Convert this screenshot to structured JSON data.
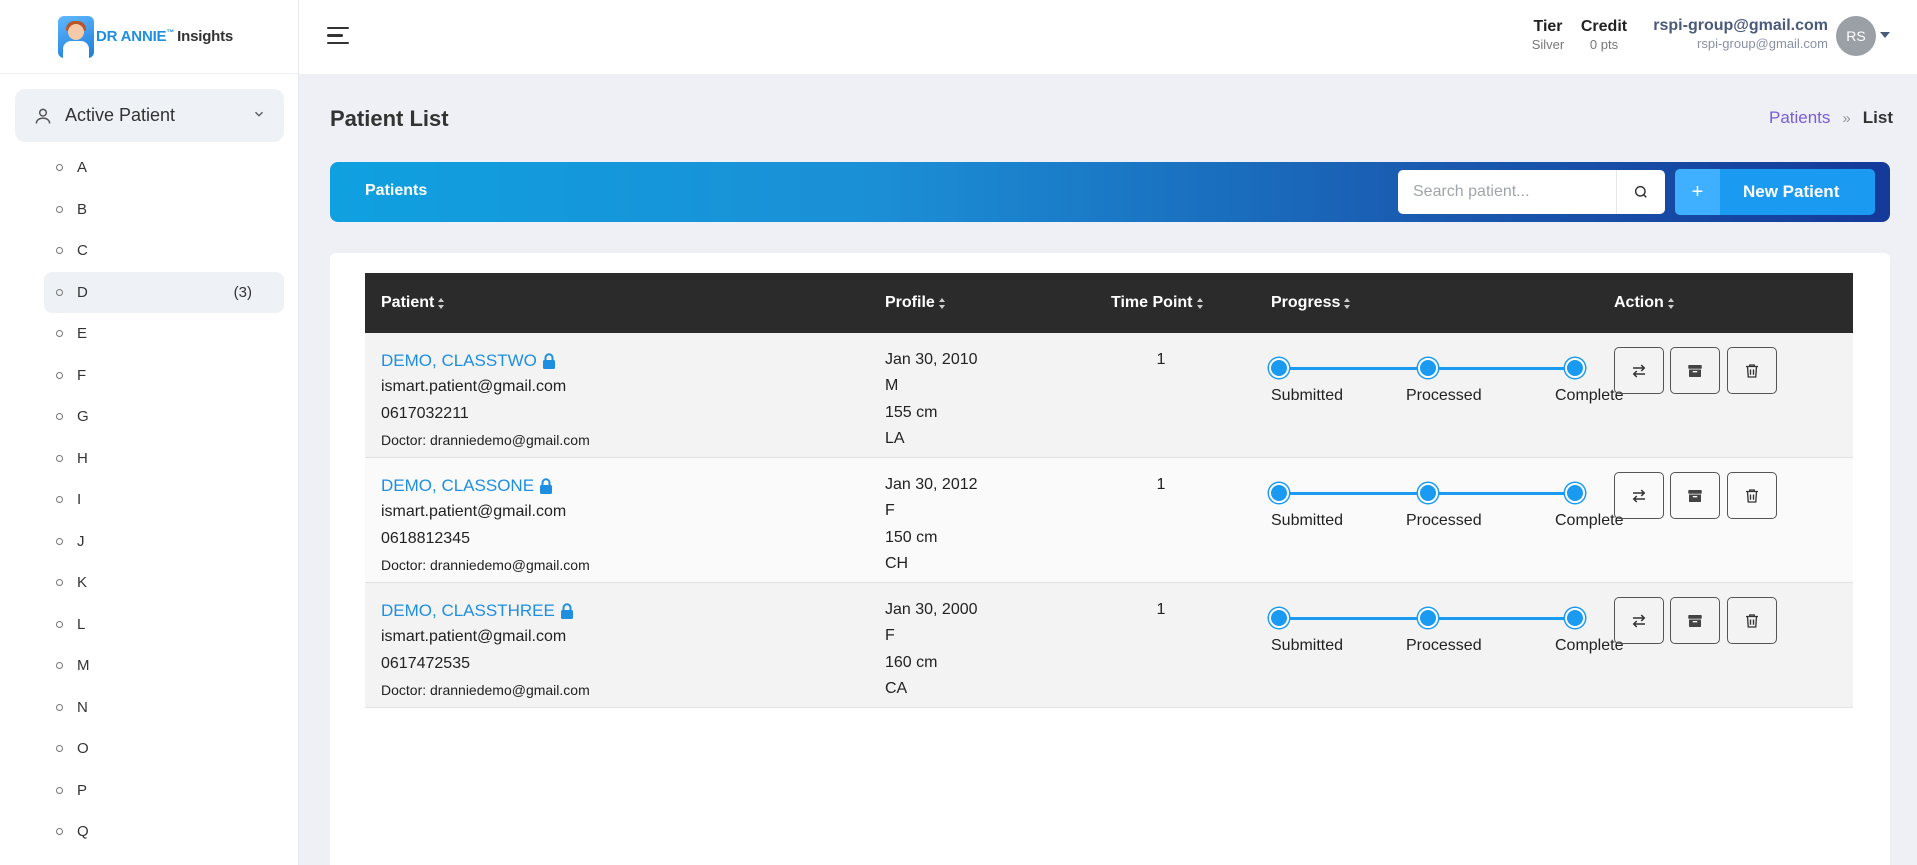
{
  "app": {
    "logo_brand": "DR ANNIE",
    "logo_tm": "™",
    "logo_suffix": "Insights"
  },
  "header": {
    "tier_title": "Tier",
    "tier_value": "Silver",
    "credit_title": "Credit",
    "credit_value": "0 pts",
    "user_name": "rspi-group@gmail.com",
    "user_email": "rspi-group@gmail.com",
    "avatar_initials": "RS"
  },
  "sidebar": {
    "section_label": "Active Patient",
    "letters": [
      {
        "label": "A",
        "count": ""
      },
      {
        "label": "B",
        "count": ""
      },
      {
        "label": "C",
        "count": ""
      },
      {
        "label": "D",
        "count": "(3)"
      },
      {
        "label": "E",
        "count": ""
      },
      {
        "label": "F",
        "count": ""
      },
      {
        "label": "G",
        "count": ""
      },
      {
        "label": "H",
        "count": ""
      },
      {
        "label": "I",
        "count": ""
      },
      {
        "label": "J",
        "count": ""
      },
      {
        "label": "K",
        "count": ""
      },
      {
        "label": "L",
        "count": ""
      },
      {
        "label": "M",
        "count": ""
      },
      {
        "label": "N",
        "count": ""
      },
      {
        "label": "O",
        "count": ""
      },
      {
        "label": "P",
        "count": ""
      },
      {
        "label": "Q",
        "count": ""
      }
    ],
    "active_letter": "D"
  },
  "main": {
    "page_title": "Patient List",
    "breadcrumb": {
      "link": "Patients",
      "separator": "»",
      "current": "List"
    },
    "banner_title": "Patients",
    "search_placeholder": "Search patient...",
    "new_button_icon": "+",
    "new_button_label": "New Patient"
  },
  "table": {
    "columns": [
      "Patient",
      "Profile",
      "Time Point",
      "Progress",
      "Action"
    ],
    "progress_steps": [
      "Submitted",
      "Processed",
      "Complete"
    ],
    "rows": [
      {
        "name": "DEMO, CLASSTWO",
        "email": "ismart.patient@gmail.com",
        "phone": "0617032211",
        "doctor": "Doctor: dranniedemo@gmail.com",
        "dob": "Jan 30, 2010",
        "sex": "M",
        "height": "155 cm",
        "location": "LA",
        "time_point": "1"
      },
      {
        "name": "DEMO, CLASSONE",
        "email": "ismart.patient@gmail.com",
        "phone": "0618812345",
        "doctor": "Doctor: dranniedemo@gmail.com",
        "dob": "Jan 30, 2012",
        "sex": "F",
        "height": "150 cm",
        "location": "CH",
        "time_point": "1"
      },
      {
        "name": "DEMO, CLASSTHREE",
        "email": "ismart.patient@gmail.com",
        "phone": "0617472535",
        "doctor": "Doctor: dranniedemo@gmail.com",
        "dob": "Jan 30, 2000",
        "sex": "F",
        "height": "160 cm",
        "location": "CA",
        "time_point": "1"
      }
    ]
  },
  "colors": {
    "accent": "#1a9af0",
    "link": "#1e8fe0",
    "breadcrumb_link": "#7a5cd6",
    "table_header": "#2b2b2b"
  },
  "icons": {
    "menu": "hamburger-icon",
    "user": "user-icon",
    "chevron": "chevron-down-icon",
    "search": "search-icon",
    "lock": "lock-icon",
    "transfer": "transfer-icon",
    "archive": "archive-icon",
    "delete": "trash-icon"
  }
}
